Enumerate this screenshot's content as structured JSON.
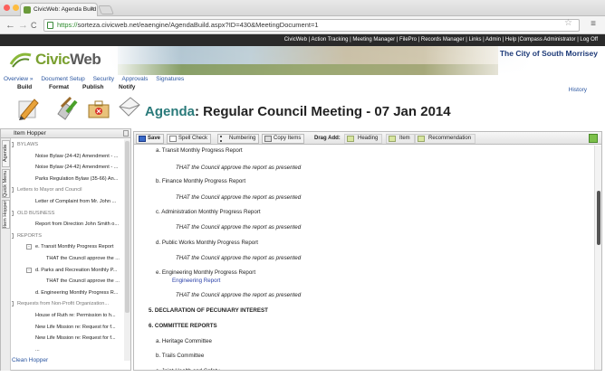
{
  "browser": {
    "tab_title": "CivicWeb: Agenda Build",
    "tab_close": "×",
    "url_scheme": "https://",
    "url_rest": "sorteza.civicweb.net/eaengine/AgendaBuild.aspx?ID=430&MeetingDocument=1",
    "back": "←",
    "forward": "→",
    "reload": "C",
    "star": "☆",
    "menu": "≡"
  },
  "topnav": {
    "text": "CivicWeb | Action Tracking | Meeting Manager | FilePro | Records Manager | Links | Admin | Help   |Compass Administrator | Log Off"
  },
  "banner": {
    "logo_civic": "Civic",
    "logo_web": "Web",
    "city": "The City of South Morrisey"
  },
  "subnav": [
    "Overview »",
    "Document Setup",
    "Security",
    "Approvals",
    "Signatures"
  ],
  "actions": [
    "Build",
    "Format",
    "Publish",
    "Notify"
  ],
  "history": "History",
  "title": {
    "label": "Agenda",
    "rest": ": Regular Council Meeting - 07 Jan 2014"
  },
  "hopper": {
    "heading": "Item Hopper",
    "vertical_tabs": [
      "Agenda",
      "Quick Menu",
      "Item Hopper"
    ],
    "items": [
      {
        "text": "BYLAWS",
        "level": 0,
        "group": true,
        "toggle": "-"
      },
      {
        "text": "Noise Bylaw (24-42) Amendment - ...",
        "level": 1
      },
      {
        "text": "Noise Bylaw (24-42) Amendment - ...",
        "level": 1
      },
      {
        "text": "Parks Regulation Bylaw (35-66) An...",
        "level": 1
      },
      {
        "text": "Letters to Mayor and Council",
        "level": 0,
        "group": true,
        "toggle": "-"
      },
      {
        "text": "Letter of Complaint from Mr. John ...",
        "level": 1
      },
      {
        "text": "OLD BUSINESS",
        "level": 0,
        "group": true,
        "toggle": "-"
      },
      {
        "text": "Report from Direction John Smith o...",
        "level": 1
      },
      {
        "text": "REPORTS",
        "level": 0,
        "group": true,
        "toggle": "-"
      },
      {
        "text": "e. Transit Monthly Progress Report",
        "level": 1,
        "toggle": "-"
      },
      {
        "text": "THAT the Council approve the ...",
        "level": 2
      },
      {
        "text": "d. Parks and Recreation Monthly P...",
        "level": 1,
        "toggle": "-"
      },
      {
        "text": "THAT the Council approve the ...",
        "level": 2
      },
      {
        "text": "d. Engineering Monthly Progress R...",
        "level": 1
      },
      {
        "text": "Requests from Non-Profit Organization...",
        "level": 0,
        "group": true,
        "toggle": "-"
      },
      {
        "text": "House of Ruth re: Permission to h...",
        "level": 1
      },
      {
        "text": "New Life Mission re: Request for f...",
        "level": 1
      },
      {
        "text": "New Life Mission re: Request for f...",
        "level": 1
      },
      {
        "text": "...",
        "level": 1
      }
    ],
    "clean": "Clean Hopper"
  },
  "toolbar": {
    "save": "Save",
    "spell": "Spell Check",
    "numbering": "Numbering",
    "copy": "Copy Items",
    "drag_add": "Drag Add:",
    "heading": "Heading",
    "item": "Item",
    "recommendation": "Recommendation"
  },
  "agenda": [
    {
      "text": "a.  Transit Monthly Progress Report",
      "kind": "item"
    },
    {
      "text": "THAT the Council approve the report as presented",
      "kind": "rec"
    },
    {
      "text": "b.  Finance Monthly Progress Report",
      "kind": "item"
    },
    {
      "text": "THAT the Council approve the report as presented",
      "kind": "rec"
    },
    {
      "text": "c.  Administration Monthly Progress Report",
      "kind": "item"
    },
    {
      "text": "THAT the Council approve the report as presented",
      "kind": "rec"
    },
    {
      "text": "d.  Public Works Monthly Progress Report",
      "kind": "item"
    },
    {
      "text": "THAT the Council approve the report as presented",
      "kind": "rec"
    },
    {
      "text": "e.  Engineering Monthly Progress Report",
      "kind": "item"
    },
    {
      "text": "Engineering Report",
      "kind": "link"
    },
    {
      "text": "THAT the Council approve the report as presented",
      "kind": "rec"
    },
    {
      "text": "5.   DECLARATION OF PECUNIARY INTEREST",
      "kind": "section"
    },
    {
      "text": "6.   COMMITTEE REPORTS",
      "kind": "section"
    },
    {
      "text": "a.  Heritage Committee",
      "kind": "item"
    },
    {
      "text": "b.  Trails Committee",
      "kind": "item"
    },
    {
      "text": "c.  Joint Health and Safety",
      "kind": "item"
    }
  ]
}
